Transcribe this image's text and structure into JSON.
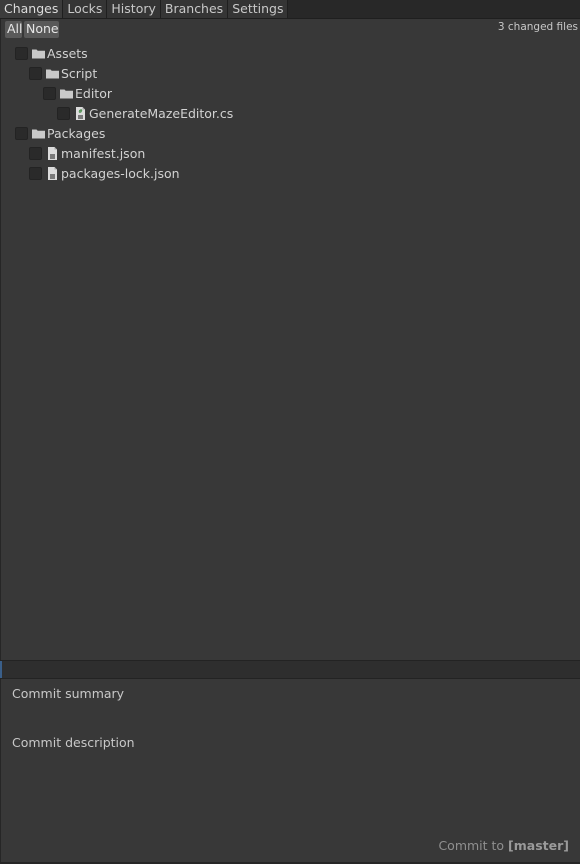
{
  "tabs": [
    {
      "label": "Changes",
      "active": true
    },
    {
      "label": "Locks",
      "active": false
    },
    {
      "label": "History",
      "active": false
    },
    {
      "label": "Branches",
      "active": false
    },
    {
      "label": "Settings",
      "active": false
    }
  ],
  "filter": {
    "all_label": "All",
    "none_label": "None",
    "changed_count": "3 changed files"
  },
  "tree": [
    {
      "label": "Assets",
      "type": "folder",
      "checked": false
    },
    {
      "label": "Script",
      "type": "folder",
      "checked": false
    },
    {
      "label": "Editor",
      "type": "folder",
      "checked": false
    },
    {
      "label": "GenerateMazeEditor.cs",
      "type": "cs-file",
      "checked": false
    },
    {
      "label": "Packages",
      "type": "folder",
      "checked": false
    },
    {
      "label": "manifest.json",
      "type": "json-file",
      "checked": false
    },
    {
      "label": "packages-lock.json",
      "type": "json-file",
      "checked": false
    }
  ],
  "commit": {
    "summary_placeholder": "Commit summary",
    "description_placeholder": "Commit description",
    "button_prefix": "Commit to ",
    "branch": "[master]"
  },
  "colors": {
    "background": "#383838",
    "tabbar": "#282828",
    "accent": "#3a5f8a"
  }
}
